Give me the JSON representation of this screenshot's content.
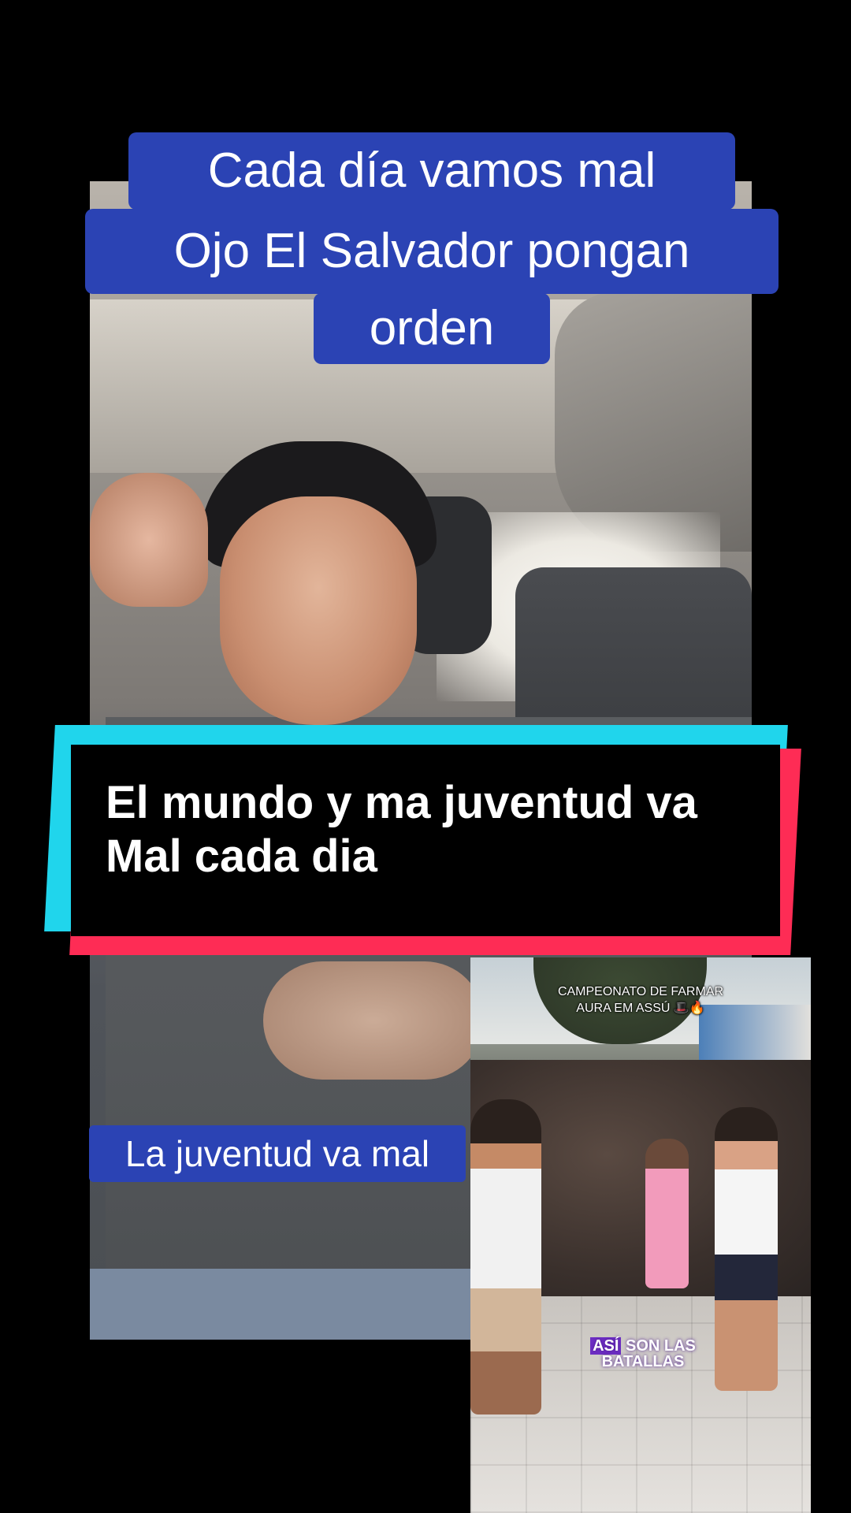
{
  "captions": {
    "top_line1": "Cada día vamos mal",
    "top_line2": "Ojo El Salvador pongan",
    "top_line3": "orden",
    "banner_line1": "El mundo y ma juventud va",
    "banner_line2": "Mal cada dia",
    "bottom_left": "La juventud va mal"
  },
  "inset_video": {
    "overlay_line1": "CAMPEONATO DE FARMAR",
    "overlay_line2": "AURA EM ASSÚ 🎩🔥",
    "logo_highlight": "ASÍ",
    "logo_rest": "SON LAS",
    "logo_line2": "BATALLAS"
  },
  "colors": {
    "caption_blue": "#2b43b4",
    "banner_cyan": "#20d5ec",
    "banner_red": "#fe2c55",
    "logo_purple": "#6d2ec3"
  }
}
